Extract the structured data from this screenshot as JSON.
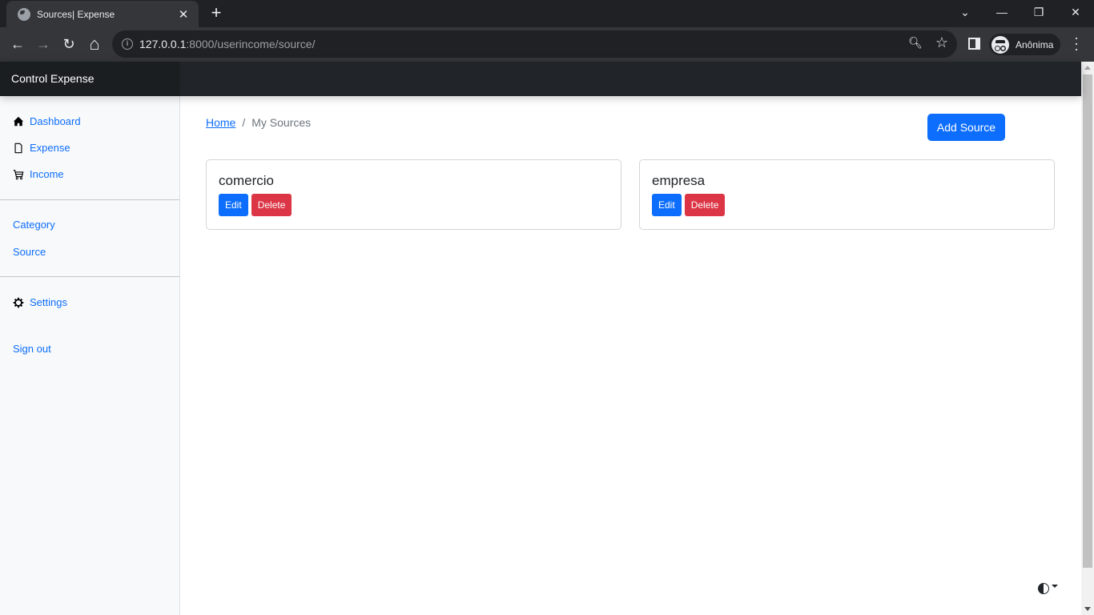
{
  "browser": {
    "tab_title": "Sources| Expense",
    "url_host": "127.0.0.1",
    "url_rest": ":8000/userincome/source/",
    "profile_label": "Anônima",
    "icons": {
      "back": "←",
      "forward": "→",
      "reload": "↻",
      "home": "⌂",
      "zoom": "🔍︎",
      "star": "☆",
      "close": "✕",
      "new_tab": "+",
      "tab_list": "⌄",
      "minimize": "—",
      "restore": "❐",
      "window_close": "✕",
      "menu": "⋮"
    }
  },
  "app": {
    "brand": "Control Expense",
    "sidebar": {
      "primary": [
        {
          "label": "Dashboard",
          "icon": "house-icon"
        },
        {
          "label": "Expense",
          "icon": "file-icon"
        },
        {
          "label": "Income",
          "icon": "cart-icon"
        }
      ],
      "secondary": [
        {
          "label": "Category"
        },
        {
          "label": "Source"
        }
      ],
      "settings": {
        "label": "Settings",
        "icon": "gear-icon"
      },
      "signout": {
        "label": "Sign out"
      }
    },
    "breadcrumb": {
      "home": "Home",
      "separator": "/",
      "current": "My Sources"
    },
    "add_button": "Add Source",
    "sources": [
      {
        "name": "comercio",
        "edit_label": "Edit",
        "delete_label": "Delete"
      },
      {
        "name": "empresa",
        "edit_label": "Edit",
        "delete_label": "Delete"
      }
    ],
    "colors": {
      "primary": "#0d6efd",
      "danger": "#dc3545",
      "navbar": "#212529"
    }
  }
}
